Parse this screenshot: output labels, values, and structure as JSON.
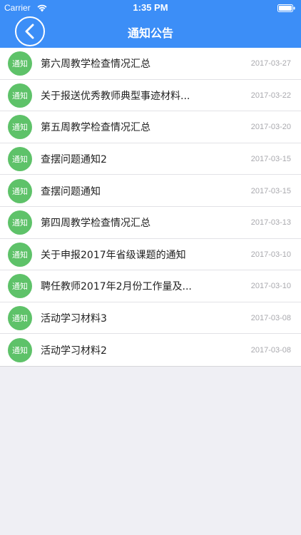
{
  "status": {
    "carrier": "Carrier",
    "time": "1:35 PM"
  },
  "nav": {
    "title": "通知公告"
  },
  "colors": {
    "accent": "#3c8ef7",
    "badge": "#5ec269"
  },
  "items": [
    {
      "badge": "通知",
      "title": "第六周教学检查情况汇总",
      "date": "2017-03-27"
    },
    {
      "badge": "通知",
      "title": "关于报送优秀教师典型事迹材料...",
      "date": "2017-03-22"
    },
    {
      "badge": "通知",
      "title": "第五周教学检查情况汇总",
      "date": "2017-03-20"
    },
    {
      "badge": "通知",
      "title": "查摆问题通知2",
      "date": "2017-03-15"
    },
    {
      "badge": "通知",
      "title": "查摆问题通知",
      "date": "2017-03-15"
    },
    {
      "badge": "通知",
      "title": "第四周教学检查情况汇总",
      "date": "2017-03-13"
    },
    {
      "badge": "通知",
      "title": "关于申报2017年省级课题的通知",
      "date": "2017-03-10"
    },
    {
      "badge": "通知",
      "title": "聘任教师2017年2月份工作量及...",
      "date": "2017-03-10"
    },
    {
      "badge": "通知",
      "title": "活动学习材料3",
      "date": "2017-03-08"
    },
    {
      "badge": "通知",
      "title": "活动学习材料2",
      "date": "2017-03-08"
    }
  ]
}
